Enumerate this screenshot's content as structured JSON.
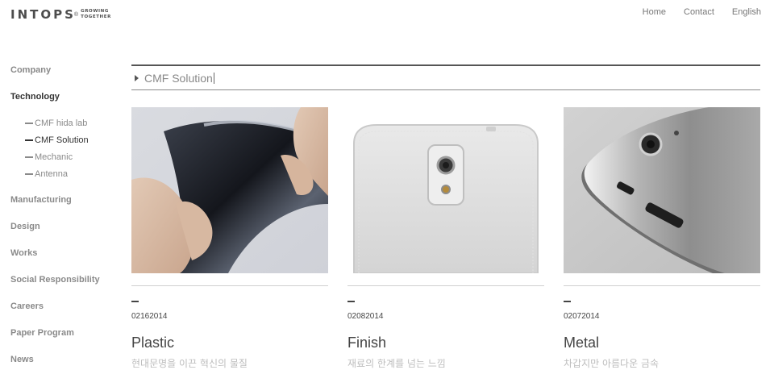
{
  "logo": {
    "word": "INTOPS",
    "reg": "®",
    "tagline_top": "GROWING",
    "tagline_bottom": "TOGETHER"
  },
  "top_nav": {
    "home": "Home",
    "contact": "Contact",
    "english": "English"
  },
  "sidebar": {
    "company": "Company",
    "technology": "Technology",
    "sub": {
      "cmf_hida_lab": "CMF hida lab",
      "cmf_solution": "CMF Solution",
      "mechanic": "Mechanic",
      "antenna": "Antenna"
    },
    "manufacturing": "Manufacturing",
    "design": "Design",
    "works": "Works",
    "social_responsibility": "Social Responsibility",
    "careers": "Careers",
    "paper_program": "Paper Program",
    "news": "News"
  },
  "main": {
    "title": "CMF Solution",
    "cards": [
      {
        "date": "02162014",
        "title": "Plastic",
        "subtitle": "현대문명을 이끈 혁신의 물질",
        "image": "hand bending black flexible plastic film"
      },
      {
        "date": "02082014",
        "title": "Finish",
        "subtitle": "재료의 한계를 넘는 느낌",
        "image": "white phone back with camera"
      },
      {
        "date": "02072014",
        "title": "Metal",
        "subtitle": "차갑지만 아름다운 금속",
        "image": "metal tablet edge closeup"
      }
    ]
  },
  "colors": {
    "accent_text": "#333333",
    "muted_text": "#8a8a8a",
    "subtitle_text": "#bdbdbd"
  }
}
